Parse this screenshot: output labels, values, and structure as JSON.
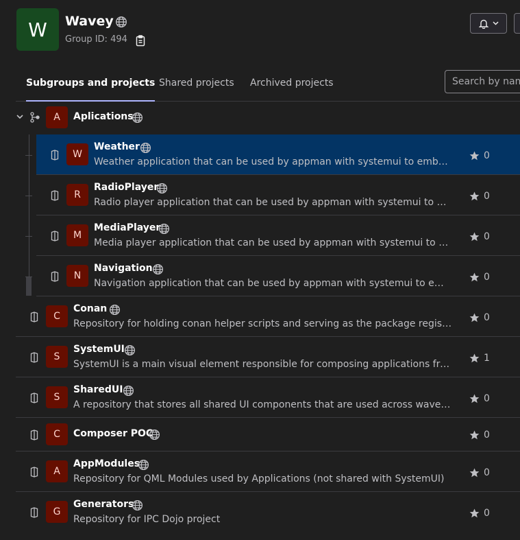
{
  "group": {
    "avatar_letter": "W",
    "name": "Wavey",
    "id_text": "Group ID: 494"
  },
  "tabs": [
    {
      "label": "Subgroups and projects",
      "active": true
    },
    {
      "label": "Shared projects",
      "active": false
    },
    {
      "label": "Archived projects",
      "active": false
    }
  ],
  "search": {
    "placeholder": "Search by name"
  },
  "subgroup": {
    "avatar_letter": "A",
    "name": "Aplications",
    "projects": [
      {
        "letter": "W",
        "name": "Weather",
        "description": "Weather application that can be used by appman with systemui to embed it o...",
        "stars": "0",
        "selected": true
      },
      {
        "letter": "R",
        "name": "RadioPlayer",
        "description": "Radio player application that can be used by appman with systemui to embed...",
        "stars": "0"
      },
      {
        "letter": "M",
        "name": "MediaPlayer",
        "description": "Media player application that can be used by appman with systemui to embe...",
        "stars": "0"
      },
      {
        "letter": "N",
        "name": "Navigation",
        "description": "Navigation application that can be used by appman with systemui to embed it...",
        "stars": "0"
      }
    ]
  },
  "projects": [
    {
      "letter": "C",
      "name": "Conan",
      "description": "Repository for holding conan helper scripts and serving as the package registry fo...",
      "stars": "0"
    },
    {
      "letter": "S",
      "name": "SystemUI",
      "description": "SystemUI is a main visual element responsible for composing applications from th...",
      "stars": "1"
    },
    {
      "letter": "S",
      "name": "SharedUI",
      "description": "A repository that stores all shared UI components that are used across wavey proj...",
      "stars": "0"
    },
    {
      "letter": "C",
      "name": "Composer POC",
      "description": "",
      "stars": "0"
    },
    {
      "letter": "A",
      "name": "AppModules",
      "description": "Repository for QML Modules used by Applications (not shared with SystemUI)",
      "stars": "0"
    },
    {
      "letter": "G",
      "name": "Generators",
      "description": "Repository for IPC Dojo project",
      "stars": "0"
    }
  ],
  "colors": {
    "background": "#1f1f1f",
    "selected_row": "#033464",
    "project_avatar": "#660e00",
    "group_avatar": "#174a20",
    "active_tab_underline": "#aeb5ff"
  }
}
